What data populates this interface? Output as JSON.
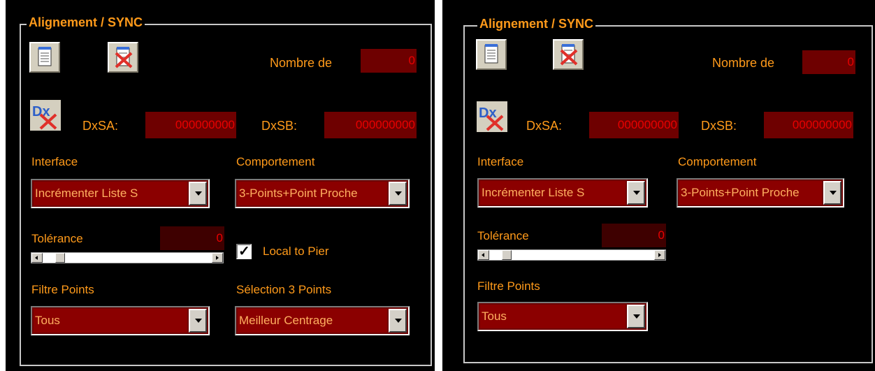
{
  "colors": {
    "background": "#000000",
    "label": "#ff9a1a",
    "field_bg": "#6e0000",
    "field_text": "#e80000",
    "frame": "#c8c8c8"
  },
  "left": {
    "title": "Alignement / SYNC",
    "nombre_label": "Nombre de",
    "nombre_value": "0",
    "dxsa_label": "DxSA:",
    "dxsa_value": "000000000",
    "dxsb_label": "DxSB:",
    "dxsb_value": "000000000",
    "interface_label": "Interface",
    "interface_value": "Incrémenter Liste S",
    "comportement_label": "Comportement",
    "comportement_value": "3-Points+Point Proche",
    "tolerance_label": "Tolérance",
    "tolerance_value": "0",
    "tolerance_level": 0,
    "local_to_pier_label": "Local to Pier",
    "local_to_pier_checked": true,
    "filtre_label": "Filtre Points",
    "filtre_value": "Tous",
    "selection_label": "Sélection 3 Points",
    "selection_value": "Meilleur Centrage"
  },
  "right": {
    "title": "Alignement / SYNC",
    "nombre_label": "Nombre de",
    "nombre_value": "0",
    "dxsa_label": "DxSA:",
    "dxsa_value": "000000000",
    "dxsb_label": "DxSB:",
    "dxsb_value": "000000000",
    "interface_label": "Interface",
    "interface_value": "Incrémenter Liste S",
    "comportement_label": "Comportement",
    "comportement_value": "3-Points+Point Proche",
    "tolerance_label": "Tolérance",
    "tolerance_value": "0",
    "tolerance_level": 0,
    "filtre_label": "Filtre Points",
    "filtre_value": "Tous"
  }
}
